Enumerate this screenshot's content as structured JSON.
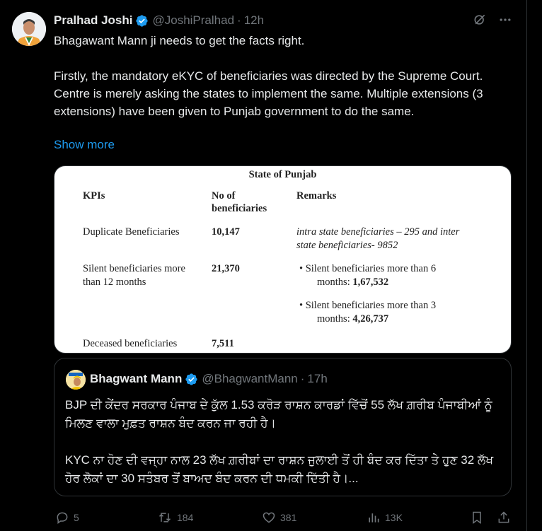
{
  "tweet": {
    "author_name": "Pralhad Joshi",
    "handle": "@JoshiPralhad",
    "separator": "·",
    "time": "12h",
    "paragraphs": [
      "Bhagawant Mann ji needs to get the facts right.",
      "Firstly, the mandatory eKYC of beneficiaries was directed by the Supreme Court. Centre is merely asking the states to implement the same. Multiple extensions (3 extensions) have been given to Punjab government to do the same."
    ],
    "show_more": "Show more"
  },
  "icons": {
    "verified": "verified-badge-icon",
    "grok": "grok-icon",
    "more": "more-icon",
    "reply": "reply-icon",
    "retweet": "retweet-icon",
    "like": "like-icon",
    "views": "views-icon",
    "bookmark": "bookmark-icon",
    "share": "share-icon"
  },
  "media_table": {
    "title": "State of Punjab",
    "headers": {
      "kpi": "KPIs",
      "count_line1": "No of",
      "count_line2": "beneficiaries",
      "remarks": "Remarks"
    },
    "rows": [
      {
        "kpi": "Duplicate Beneficiaries",
        "count": "10,147",
        "remark_line1": "intra state beneficiaries – 295 and inter",
        "remark_line2": "state beneficiaries- 9852"
      },
      {
        "kpi_line1": "Silent beneficiaries more",
        "kpi_line2": "than 12 months",
        "count": "21,370",
        "bullet1_line1": "Silent beneficiaries more than 6",
        "bullet1_prefix": "months: ",
        "bullet1_value": "1,67,532",
        "bullet2_line1": "Silent beneficiaries more than 3",
        "bullet2_prefix": "months: ",
        "bullet2_value": "4,26,737"
      },
      {
        "kpi": "Deceased beneficiaries",
        "count": "7,511"
      }
    ]
  },
  "quote": {
    "author_name": "Bhagwant Mann",
    "handle": "@BhagwantMann",
    "separator": "·",
    "time": "17h",
    "paragraphs": [
      "BJP ਦੀ ਕੇਂਦਰ ਸਰਕਾਰ ਪੰਜਾਬ ਦੇ ਕੁੱਲ 1.53 ਕਰੋੜ ਰਾਸ਼ਨ ਕਾਰਡਾਂ ਵਿੱਚੋਂ 55 ਲੱਖ ਗ਼ਰੀਬ ਪੰਜਾਬੀਆਂ ਨੂੰ ਮਿਲਣ ਵਾਲਾ ਮੁਫ਼ਤ ਰਾਸ਼ਨ ਬੰਦ ਕਰਨ ਜਾ ਰਹੀ ਹੈ।",
      "KYC ਨਾ ਹੋਣ ਦੀ ਵਜ੍ਹਾ ਨਾਲ 23 ਲੱਖ ਗ਼ਰੀਬਾਂ ਦਾ ਰਾਸ਼ਨ ਜੁਲਾਈ ਤੋਂ ਹੀ ਬੰਦ ਕਰ ਦਿੱਤਾ ਤੇ ਹੁਣ 32 ਲੱਖ ਹੋਰ ਲੋਕਾਂ ਦਾ 30 ਸਤੰਬਰ ਤੋਂ ਬਾਅਦ ਬੰਦ ਕਰਨ ਦੀ ਧਮਕੀ ਦਿੱਤੀ ਹੈ।..."
    ]
  },
  "actions": {
    "replies": "5",
    "retweets": "184",
    "likes": "381",
    "views": "13K"
  },
  "colors": {
    "background": "#000000",
    "text": "#e7e9ea",
    "muted": "#71767b",
    "link": "#1d9bf0",
    "border": "#2f3336",
    "verified": "#1d9bf0"
  }
}
